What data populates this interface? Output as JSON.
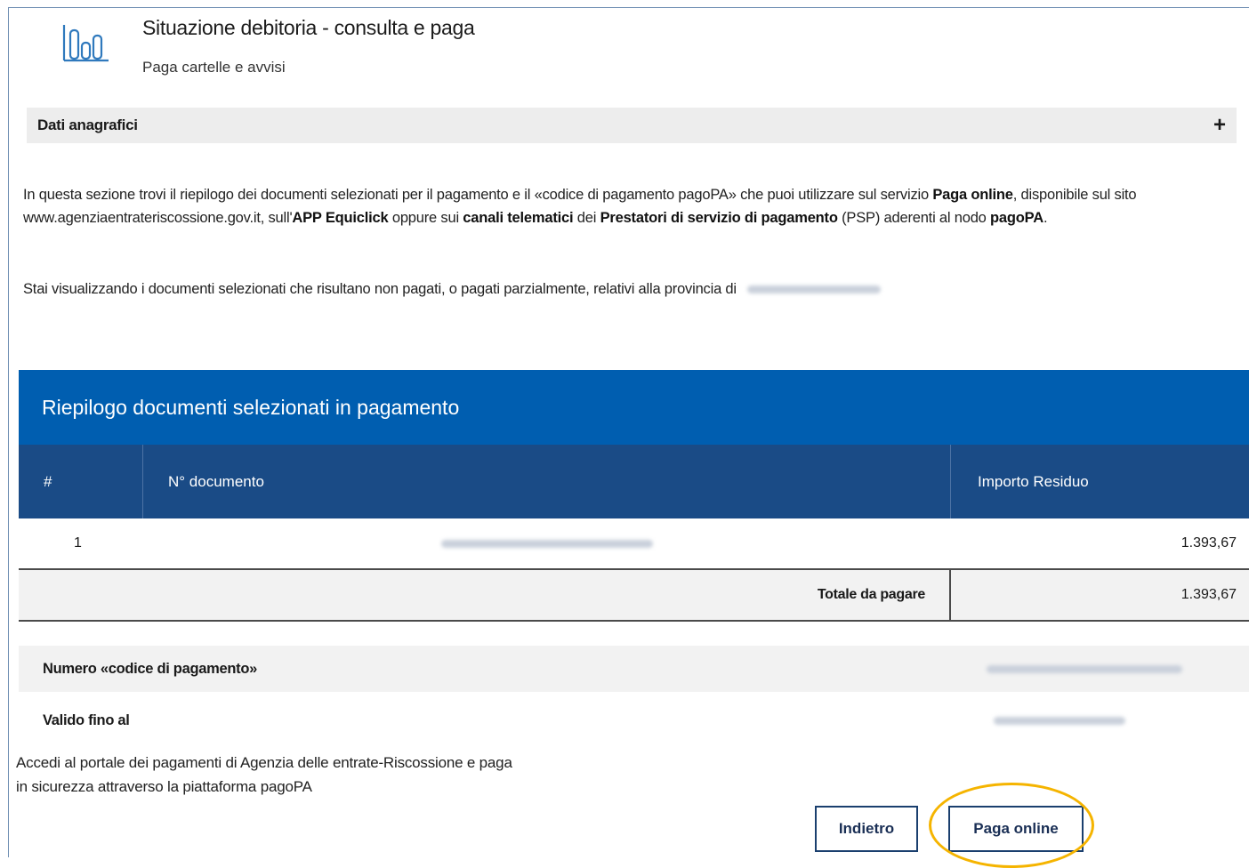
{
  "header": {
    "title": "Situazione debitoria - consulta e paga",
    "subtitle": "Paga cartelle e avvisi",
    "icon": "bar-chart-icon"
  },
  "accordion": {
    "label": "Dati anagrafici",
    "toggle": "+"
  },
  "intro": {
    "t1": "In questa sezione trovi il riepilogo dei documenti selezionati per il pagamento e il «codice di pagamento pagoPA» che puoi utilizzare sul servizio ",
    "b1": "Paga online",
    "t2": ", disponibile sul sito www.agenziaentrateriscossione.gov.it, sull'",
    "b2": "APP Equiclick",
    "t3": " oppure sui ",
    "b3": "canali telematici",
    "t4": " dei ",
    "b4": "Prestatori di servizio di pagamento",
    "t5": " (PSP) aderenti al nodo ",
    "b5": "pagoPA",
    "t6": "."
  },
  "province_text": "Stai visualizzando i documenti selezionati che risultano non pagati, o pagati parzialmente, relativi alla provincia di",
  "summary": {
    "title": "Riepilogo documenti selezionati in pagamento",
    "columns": [
      "#",
      "N° documento",
      "Importo Residuo"
    ],
    "rows": [
      {
        "index": "1",
        "amount": "1.393,67"
      }
    ],
    "total_label": "Totale da pagare",
    "total_value": "1.393,67"
  },
  "payment_info": {
    "code_label": "Numero «codice di pagamento»",
    "valid_label": "Valido fino al"
  },
  "portal_text": {
    "line1": "Accedi al portale dei pagamenti di Agenzia delle entrate-Riscossione e paga",
    "line2": "in sicurezza attraverso la piattaforma pagoPA"
  },
  "buttons": {
    "back": "Indietro",
    "pay": "Paga online"
  },
  "colors": {
    "panel_header": "#005eb0",
    "table_header": "#1a4b86",
    "highlight": "#f5b400",
    "button_border": "#1a3f6e"
  }
}
